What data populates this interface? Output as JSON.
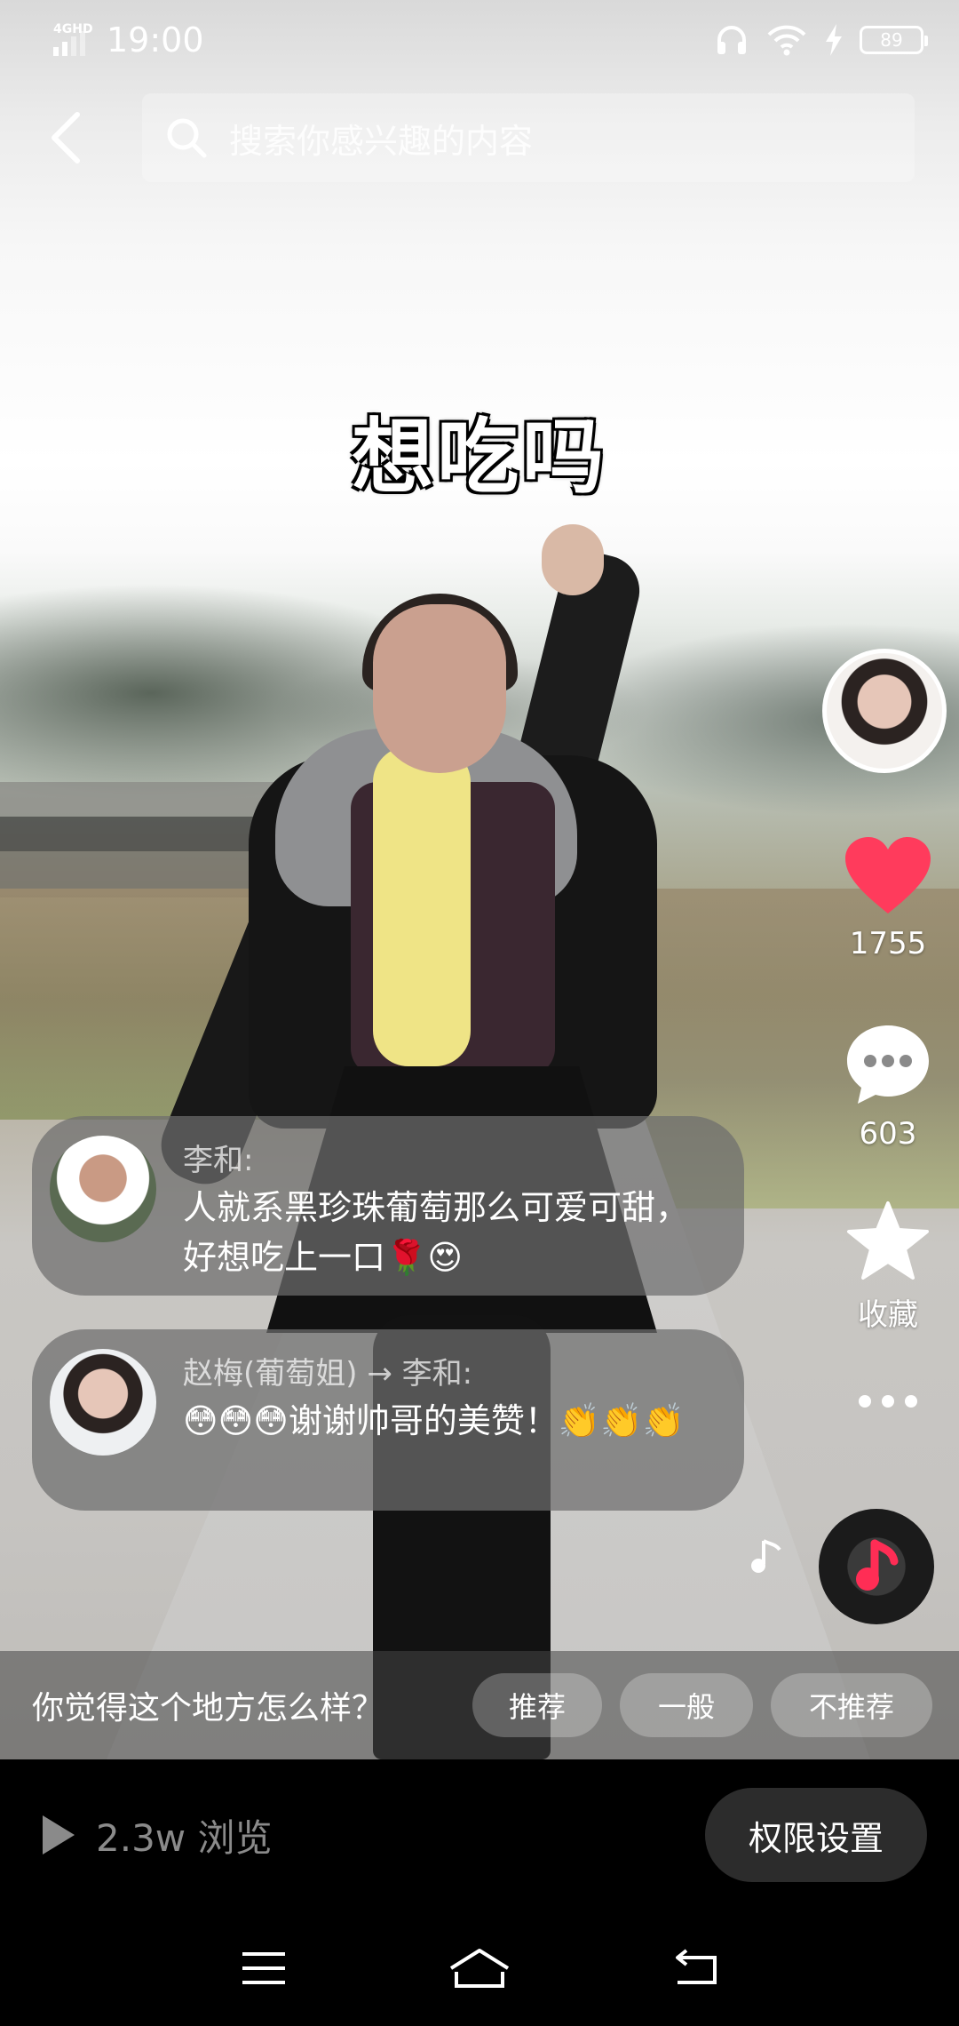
{
  "status_bar": {
    "network": "4GHD",
    "time": "19:00",
    "battery": "89",
    "icons": [
      "signal-icon",
      "headphones-icon",
      "wifi-icon",
      "charging-icon",
      "battery-icon"
    ]
  },
  "search": {
    "placeholder": "搜索你感兴趣的内容"
  },
  "video": {
    "caption": "想吃吗"
  },
  "actions": {
    "like_count": "1755",
    "comment_count": "603",
    "favorite_label": "收藏"
  },
  "comments": [
    {
      "author": "李和:",
      "text": "人就系黑珍珠葡萄那么可爱可甜，好想吃上一口🌹😍"
    },
    {
      "author": "赵梅(葡萄姐) → 李和:",
      "text": "😳😳😳谢谢帅哥的美赞！👏👏👏"
    }
  ],
  "rating": {
    "question": "你觉得这个地方怎么样？",
    "options": [
      "推荐",
      "一般",
      "不推荐"
    ]
  },
  "footer": {
    "views": "2.3w 浏览",
    "permission_button": "权限设置"
  },
  "colors": {
    "like": "#ff3b5c",
    "music_accent": "#ff2d55",
    "bubble_bg": "rgba(110,110,110,.72)"
  }
}
